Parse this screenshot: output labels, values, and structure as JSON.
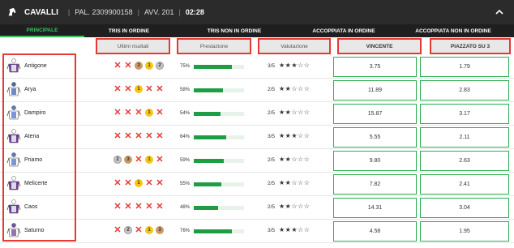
{
  "header": {
    "title": "CAVALLI",
    "pal": "PAL. 2309900158",
    "avv": "AVV. 201",
    "time": "02:28"
  },
  "tabs": [
    {
      "label": "PRINCIPALE",
      "active": true
    },
    {
      "label": "TRIS IN ORDINE",
      "active": false
    },
    {
      "label": "TRIS NON IN ORDINE",
      "active": false
    },
    {
      "label": "ACCOPPIATA IN ORDINE",
      "active": false
    },
    {
      "label": "ACCOPPIATA NON IN ORDINE",
      "active": false
    }
  ],
  "columns": {
    "results": "Ultimi risultati",
    "performance": "Prestazione",
    "rating": "Valutazione",
    "win": "VINCENTE",
    "place": "PIAZZATO SU 3"
  },
  "colors": {
    "accent": "#38c25a",
    "bar": "#1e9e43",
    "loss": "#e53935",
    "highlight": "#e53935"
  },
  "horses": [
    {
      "name": "Antigone",
      "results": [
        "x",
        "x",
        "3",
        "1",
        "2"
      ],
      "pct": "75%",
      "pct_value": 75,
      "rating": "3/5",
      "stars": 3,
      "win": "3.75",
      "place": "1.79",
      "silk": [
        "#7b4fa0",
        "#ffffff"
      ]
    },
    {
      "name": "Arya",
      "results": [
        "x",
        "x",
        "1",
        "x",
        "x"
      ],
      "pct": "58%",
      "pct_value": 58,
      "rating": "2/5",
      "stars": 2,
      "win": "11.89",
      "place": "2.83",
      "silk": [
        "#ffffff",
        "#4b6cb7"
      ]
    },
    {
      "name": "Dampiro",
      "results": [
        "x",
        "x",
        "x",
        "1",
        "x"
      ],
      "pct": "54%",
      "pct_value": 54,
      "rating": "2/5",
      "stars": 2,
      "win": "15.87",
      "place": "3.17",
      "silk": [
        "#ffffff",
        "#5a7bc9"
      ]
    },
    {
      "name": "Atena",
      "results": [
        "x",
        "x",
        "x",
        "x",
        "x"
      ],
      "pct": "64%",
      "pct_value": 64,
      "rating": "3/5",
      "stars": 3,
      "win": "5.55",
      "place": "2.11",
      "silk": [
        "#6a3d9a",
        "#ffffff"
      ]
    },
    {
      "name": "Priamo",
      "results": [
        "2",
        "3",
        "x",
        "1",
        "x"
      ],
      "pct": "59%",
      "pct_value": 59,
      "rating": "2/5",
      "stars": 2,
      "win": "9.80",
      "place": "2.63",
      "silk": [
        "#ffffff",
        "#5a7bc9"
      ]
    },
    {
      "name": "Melicerte",
      "results": [
        "x",
        "x",
        "1",
        "x",
        "x"
      ],
      "pct": "55%",
      "pct_value": 55,
      "rating": "2/5",
      "stars": 2,
      "win": "7.82",
      "place": "2.41",
      "silk": [
        "#6a3d9a",
        "#ffffff"
      ]
    },
    {
      "name": "Caos",
      "results": [
        "x",
        "x",
        "x",
        "x",
        "x"
      ],
      "pct": "48%",
      "pct_value": 48,
      "rating": "2/5",
      "stars": 2,
      "win": "14.31",
      "place": "3.04",
      "silk": [
        "#6a3d9a",
        "#ffffff"
      ]
    },
    {
      "name": "Saturno",
      "results": [
        "x",
        "2",
        "x",
        "1",
        "3"
      ],
      "pct": "76%",
      "pct_value": 76,
      "rating": "3/5",
      "stars": 3,
      "win": "4.58",
      "place": "1.95",
      "silk": [
        "#ffffff",
        "#7b4fa0"
      ]
    }
  ]
}
